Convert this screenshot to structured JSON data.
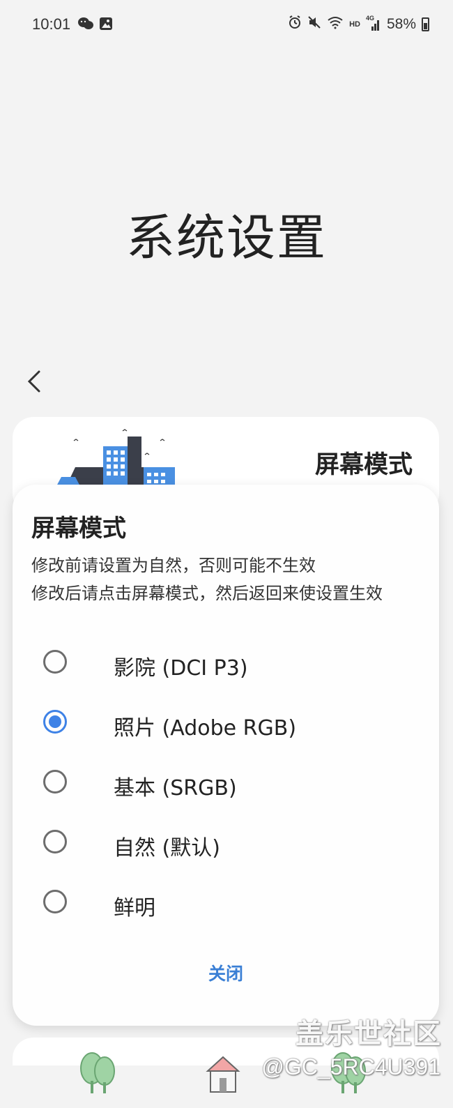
{
  "status_bar": {
    "time": "10:01",
    "hd_label": "HD",
    "network_label": "4G",
    "battery_percent": "58%"
  },
  "page": {
    "title": "系统设置"
  },
  "card": {
    "title": "屏幕模式"
  },
  "dialog": {
    "title": "屏幕模式",
    "message_line1": "修改前请设置为自然，否则可能不生效",
    "message_line2": "修改后请点击屏幕模式，然后返回来使设置生效",
    "options": [
      {
        "label": "影院 (DCI P3)",
        "selected": false
      },
      {
        "label": "照片 (Adobe RGB)",
        "selected": true
      },
      {
        "label": "基本 (SRGB)",
        "selected": false
      },
      {
        "label": "自然 (默认)",
        "selected": false
      },
      {
        "label": "鲜明",
        "selected": false
      }
    ],
    "close_label": "关闭"
  },
  "watermark": {
    "site": "盖乐世社区",
    "user": "@GC_5RC4U391"
  },
  "colors": {
    "accent": "#3e82e6",
    "close_text": "#3a7fd5",
    "background": "#f3f3f3"
  }
}
